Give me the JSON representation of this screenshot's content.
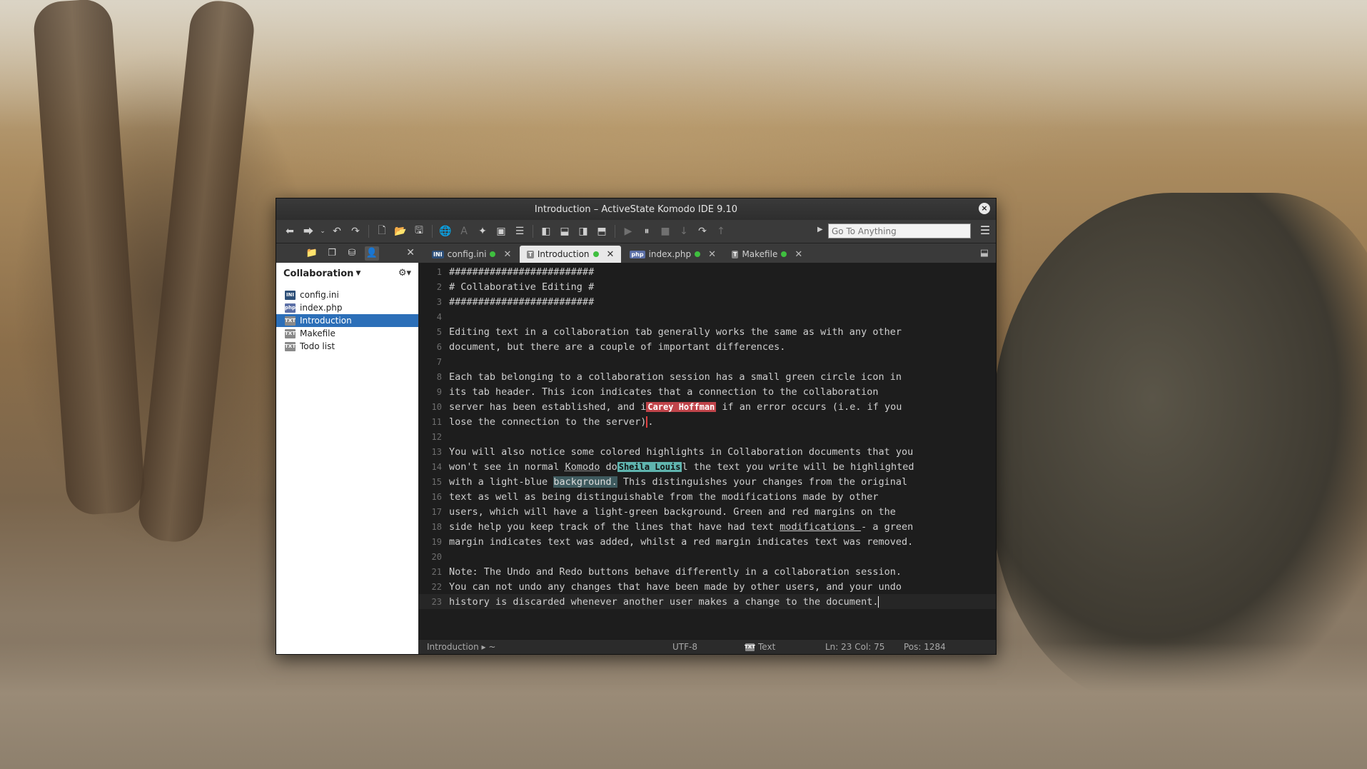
{
  "window": {
    "title": "Introduction – ActiveState Komodo IDE 9.10",
    "close_glyph": "×"
  },
  "toolbar": {
    "goto_placeholder": "Go To Anything"
  },
  "tabs": [
    {
      "label": "config.ini",
      "badge": "INI",
      "active": false
    },
    {
      "label": "Introduction",
      "badge": "T",
      "active": true
    },
    {
      "label": "index.php",
      "badge": "php",
      "active": false
    },
    {
      "label": "Makefile",
      "badge": "T",
      "active": false
    }
  ],
  "sidebar": {
    "title": "Collaboration",
    "items": [
      {
        "label": "config.ini",
        "badge": "INI"
      },
      {
        "label": "index.php",
        "badge": "php"
      },
      {
        "label": "Introduction",
        "badge": "TXT"
      },
      {
        "label": "Makefile",
        "badge": "TXT"
      },
      {
        "label": "Todo list",
        "badge": "TXT"
      }
    ]
  },
  "editor": {
    "lines": [
      "#########################",
      "# Collaborative Editing #",
      "#########################",
      "",
      "Editing text in a collaboration tab generally works the same as with any other",
      "document, but there are a couple of important differences.",
      "",
      "Each tab belonging to a collaboration session has a small green circle icon in",
      "its tab header. This icon indicates that a connection to the collaboration",
      "server has been established, and i",
      "lose the connection to the server)",
      "",
      "You will also notice some colored highlights in Collaboration documents that you",
      "won't see in normal ",
      "with a light-blue ",
      "text as well as being distinguishable from the modifications made by other",
      "users, which will have a light-green background. Green and red margins on the",
      "side help you keep track of the lines that have had text ",
      "margin indicates text was added, whilst a red margin indicates text was removed.",
      "",
      "Note: The Undo and Redo buttons behave differently in a collaboration session.",
      "You can not undo any changes that have been made by other users, and your undo",
      "history is discarded whenever another user makes a change to the document."
    ],
    "line10_tail": " if an error occurs (i.e. if you",
    "line11_tail": ".",
    "line14_word": "Komodo",
    "line14_mid": " do",
    "line14_tail": "l the text you write will be highlighted",
    "line15_hl": "background.",
    "line15_tail": " This distinguishes your changes from the original",
    "line18_link": "modifications ",
    "line18_tail": "- a green",
    "users": {
      "red": "Carey Hoffman",
      "teal": "Sheila Louis"
    }
  },
  "status": {
    "breadcrumb": "Introduction ▸ ~",
    "encoding": "UTF-8",
    "language": "Text",
    "position": "Ln: 23 Col: 75",
    "pos": "Pos: 1284"
  },
  "colors": {
    "tab_dot": "#3fbf3f",
    "selection": "#2c6fb8",
    "user_red": "#c0444a",
    "user_teal": "#5fb4ae"
  }
}
